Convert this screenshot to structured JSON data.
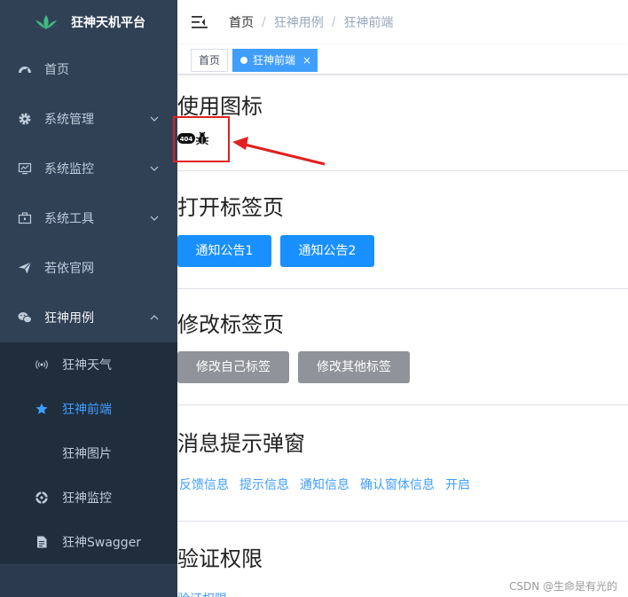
{
  "sidebar": {
    "logo_title": "狂神天机平台",
    "items": [
      {
        "label": "首页",
        "icon": "dashboard-icon"
      },
      {
        "label": "系统管理",
        "icon": "gear-icon"
      },
      {
        "label": "系统监控",
        "icon": "monitor-icon"
      },
      {
        "label": "系统工具",
        "icon": "toolbox-icon"
      },
      {
        "label": "若依官网",
        "icon": "send-icon"
      },
      {
        "label": "狂神用例",
        "icon": "wechat-icon"
      }
    ],
    "subitems": [
      {
        "label": "狂神天气",
        "icon": "broadcast-icon"
      },
      {
        "label": "狂神前端",
        "icon": "star-icon"
      },
      {
        "label": "狂神图片",
        "icon": ""
      },
      {
        "label": "狂神监控",
        "icon": "monitor-circle-icon"
      },
      {
        "label": "狂神Swagger",
        "icon": "document-icon"
      }
    ]
  },
  "navbar": {
    "breadcrumb": [
      "首页",
      "狂神用例",
      "狂神前端"
    ],
    "separator": "/"
  },
  "tags": {
    "home": "首页",
    "active": "狂神前端",
    "close": "×"
  },
  "sections": {
    "icons": {
      "title": "使用图标"
    },
    "open_tab": {
      "title": "打开标签页",
      "buttons": [
        "通知公告1",
        "通知公告2"
      ]
    },
    "modify_tab": {
      "title": "修改标签页",
      "buttons": [
        "修改自己标签",
        "修改其他标签"
      ]
    },
    "message": {
      "title": "消息提示弹窗",
      "links": [
        "反馈信息",
        "提示信息",
        "通知信息",
        "确认窗体信息",
        "开启"
      ]
    },
    "permission": {
      "title": "验证权限",
      "links": [
        "验证权限"
      ]
    }
  },
  "watermark": "CSDN @生命是有光的",
  "colors": {
    "sidebar_bg": "#304156",
    "submenu_bg": "#1f2d3d",
    "active": "#409eff",
    "primary_button": "#1890ff",
    "gray_button": "#909399",
    "annotation": "#e02020"
  }
}
